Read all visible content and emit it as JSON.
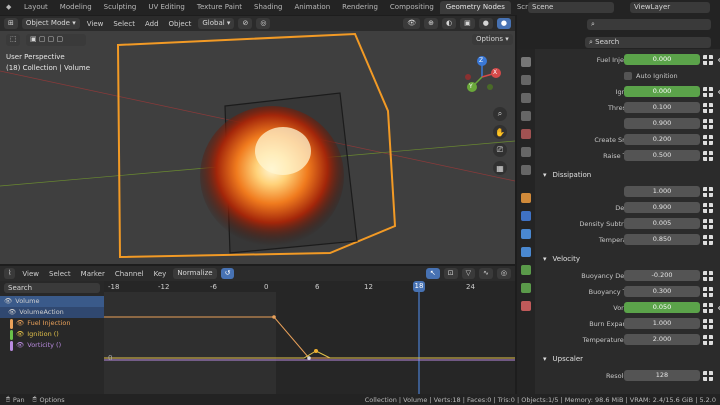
{
  "workspace_tabs": [
    "Layout",
    "Modeling",
    "Sculpting",
    "UV Editing",
    "Texture Paint",
    "Shading",
    "Animation",
    "Rendering",
    "Compositing",
    "Geometry Nodes",
    "Scripting"
  ],
  "active_workspace": "Geometry Nodes",
  "scene": {
    "name": "Scene",
    "view_layer": "ViewLayer"
  },
  "viewport": {
    "mode": "Object Mode",
    "menus": [
      "View",
      "Select",
      "Add",
      "Object"
    ],
    "orientation": "Global",
    "options_label": "Options",
    "overlay_title": "User Perspective",
    "overlay_collection": "(18) Collection | Volume",
    "gizmo_axes": {
      "x": "X",
      "y": "Y",
      "z": "Z"
    }
  },
  "timeline": {
    "menus": [
      "View",
      "Select",
      "Marker",
      "Channel",
      "Key"
    ],
    "normalize_label": "Normalize",
    "search_placeholder": "Search",
    "frame_ticks": [
      "-18",
      "-12",
      "-6",
      "0",
      "6",
      "12",
      "18",
      "24"
    ],
    "current_frame": "18",
    "zero_label": "0",
    "channels": [
      {
        "label": "Volume",
        "color": "#c8c8c8"
      },
      {
        "label": "VolumeAction",
        "color": "#c8c8c8"
      },
      {
        "label": "Fuel Injection",
        "color": "#e9a15a"
      },
      {
        "label": "Ignition ()",
        "color": "#e3c24a"
      },
      {
        "label": "Vorticity ()",
        "color": "#b98be0"
      }
    ]
  },
  "properties": {
    "search_placeholder": "Search",
    "rows": [
      {
        "label": "Fuel Injection",
        "value": "0.000",
        "green": true
      },
      {
        "label": "Auto Ignition",
        "checkbox": true
      },
      {
        "label": "Ignition",
        "value": "0.000",
        "green": true
      },
      {
        "label": "Threshold",
        "value": "0.100"
      },
      {
        "label": "Rate",
        "value": "0.900"
      },
      {
        "label": "Create Smoke",
        "value": "0.200"
      },
      {
        "label": "Raise Temp",
        "value": "0.500"
      },
      {
        "section": "Dissipation"
      },
      {
        "label": "Fuel",
        "value": "1.000"
      },
      {
        "label": "Density",
        "value": "0.900"
      },
      {
        "label": "Density Subtract...",
        "value": "0.005"
      },
      {
        "label": "Temperature",
        "value": "0.850"
      },
      {
        "section": "Velocity"
      },
      {
        "label": "Buoyancy Density",
        "value": "-0.200"
      },
      {
        "label": "Buoyancy Temp",
        "value": "0.300"
      },
      {
        "label": "Vorticity",
        "value": "0.050",
        "green": true
      },
      {
        "label": "Burn Expansion",
        "value": "1.000"
      },
      {
        "label": "Temperature Ex...",
        "value": "2.000"
      },
      {
        "section": "Upscaler"
      },
      {
        "label": "Resolution",
        "value": "128"
      }
    ]
  },
  "statusbar": {
    "left1": "Pan",
    "left2": "Options",
    "right": "Collection | Volume | Verts:18 | Faces:0 | Tris:0 | Objects:1/5 | Memory: 98.6 MiB | VRAM: 2.4/15.6 GiB | 5.2.0"
  }
}
